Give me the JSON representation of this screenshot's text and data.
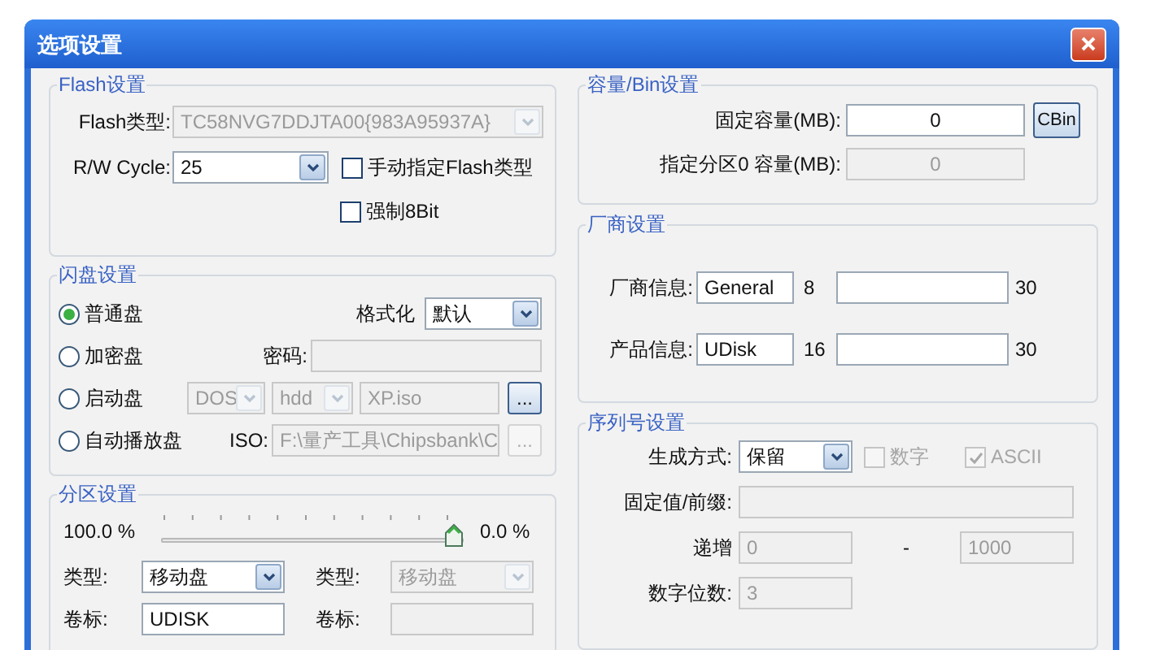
{
  "window": {
    "title": "选项设置"
  },
  "flash_settings": {
    "title": "Flash设置",
    "flash_type_label": "Flash类型:",
    "flash_type": {
      "value": "TC58NVG7DDJTA00{983A95937A}",
      "disabled": true
    },
    "rw_cycle_label": "R/W Cycle:",
    "rw_cycle": {
      "value": "25",
      "disabled": false
    },
    "manual_flash_type": {
      "label": "手动指定Flash类型",
      "checked": false,
      "disabled": false
    },
    "force_8bit": {
      "label": "强制8Bit",
      "checked": false,
      "disabled": false
    }
  },
  "disk_settings": {
    "title": "闪盘设置",
    "modes": [
      {
        "label": "普通盘",
        "selected": true
      },
      {
        "label": "加密盘",
        "selected": false
      },
      {
        "label": "启动盘",
        "selected": false
      },
      {
        "label": "自动播放盘",
        "selected": false
      }
    ],
    "format_label": "格式化",
    "format": {
      "value": "默认",
      "disabled": false
    },
    "password_label": "密码:",
    "password": {
      "disabled": true
    },
    "boot_os": {
      "value": "DOS",
      "disabled": true
    },
    "boot_type": {
      "value": "hdd",
      "disabled": true
    },
    "boot_image": {
      "value": "XP.iso",
      "disabled": true
    },
    "boot_browse": {
      "label": "...",
      "disabled": false
    },
    "iso_label": "ISO:",
    "iso_path": {
      "value": "F:\\量产工具\\Chipsbank\\C",
      "disabled": true
    },
    "iso_browse": {
      "label": "...",
      "disabled": true
    }
  },
  "partition_settings": {
    "title": "分区设置",
    "left_percent": "100.0 %",
    "right_percent": "0.0 %",
    "level": 1,
    "type_label": "类型:",
    "type": {
      "value": "移动盘",
      "disabled": false
    },
    "type_2_label": "类型:",
    "type_2": {
      "value": "移动盘",
      "disabled": true
    },
    "volume_label": "卷标:",
    "volume": {
      "value": "UDISK",
      "disabled": false
    },
    "volume_2_label": "卷标:",
    "volume_2": {
      "disabled": true
    }
  },
  "capacity_settings": {
    "title": "容量/Bin设置",
    "fixed_label": "固定容量(MB):",
    "fixed": {
      "value": "0",
      "disabled": false
    },
    "cbin_button": "CBin",
    "partition0_label": "指定分区0 容量(MB):",
    "partition0": {
      "value": "0",
      "disabled": true
    }
  },
  "vendor_settings": {
    "title": "厂商设置",
    "rows": [
      {
        "label": "厂商信息:",
        "value": "General",
        "length": "8",
        "max": "30"
      },
      {
        "label": "产品信息:",
        "value": "UDisk",
        "length": "16",
        "max": "30"
      }
    ]
  },
  "serial_settings": {
    "title": "序列号设置",
    "mode_label": "生成方式:",
    "mode": {
      "value": "保留",
      "disabled": false
    },
    "digits_check": {
      "label": "数字",
      "checked": false,
      "disabled": true
    },
    "ascii_check": {
      "label": "ASCII",
      "checked": true,
      "disabled": true
    },
    "prefix_label": "固定值/前缀:",
    "prefix": {
      "disabled": true
    },
    "increment_label": "递增",
    "start": {
      "value": "0",
      "disabled": true
    },
    "dash": "-",
    "end": {
      "value": "1000",
      "disabled": true
    },
    "digit_count_label": "数字位数:",
    "digit_count": {
      "value": "3",
      "disabled": true
    }
  }
}
